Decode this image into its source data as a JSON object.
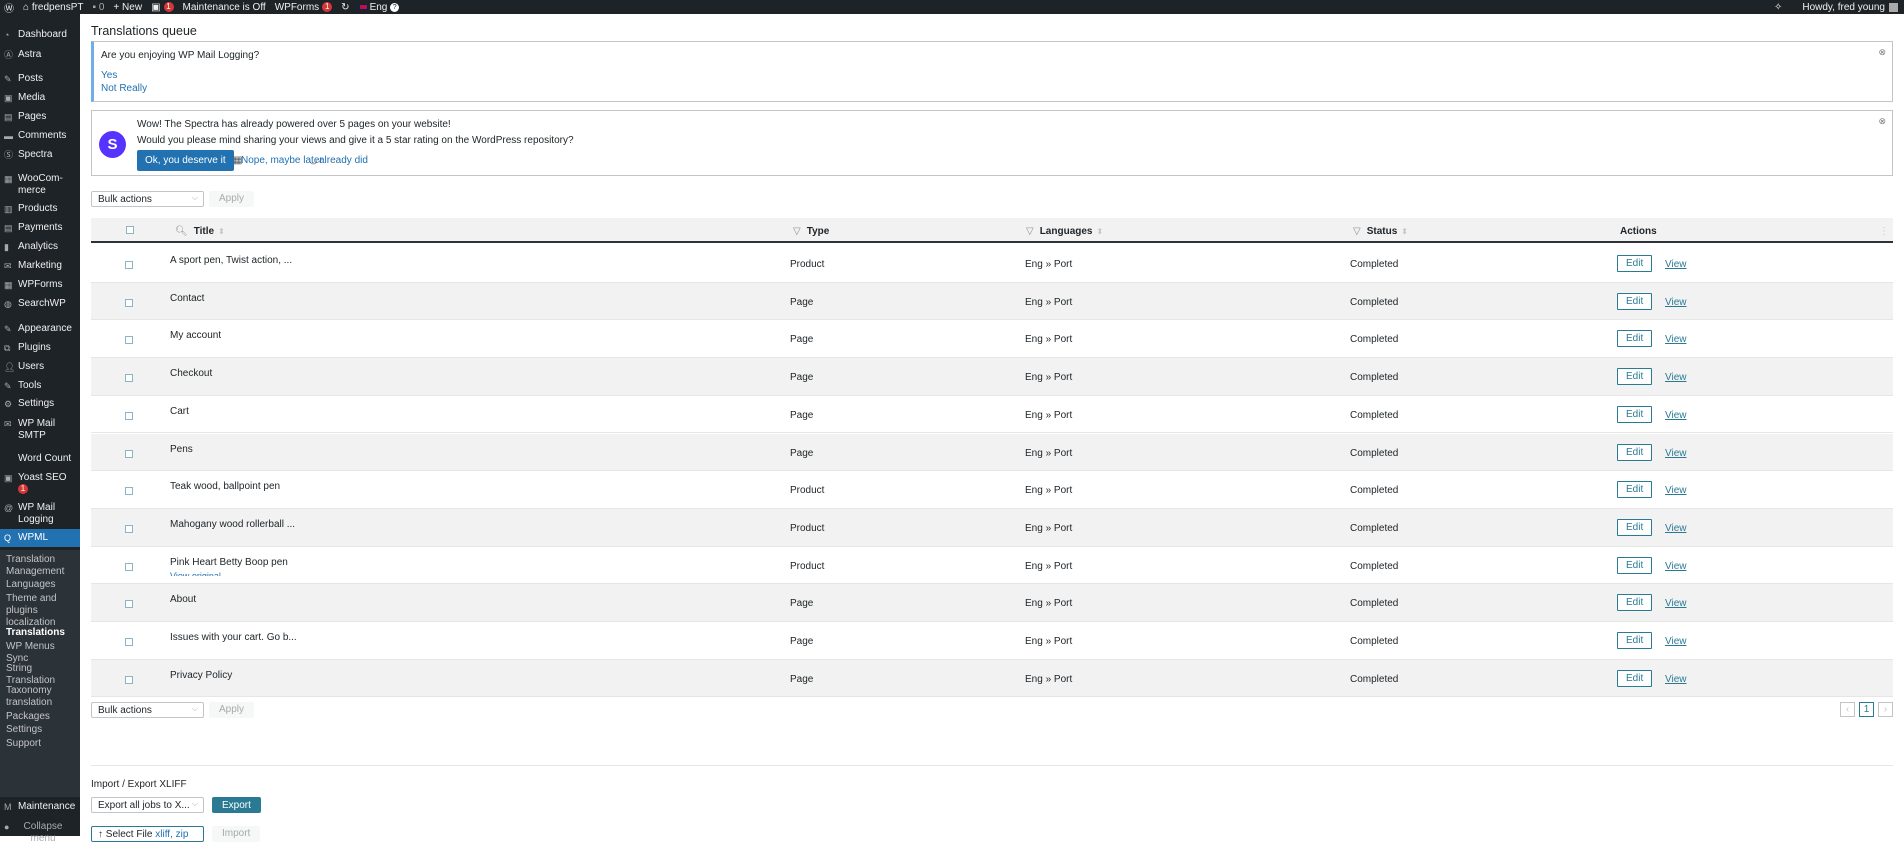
{
  "adminbar": {
    "site": "fredpensPT",
    "comments": "0",
    "new": "New",
    "yoast_badge": "1",
    "maintenance": "Maintenance is Off",
    "wpforms": "WPForms",
    "wpforms_badge": "1",
    "lang": "Eng",
    "howdy": "Howdy, fred young"
  },
  "sidebar": {
    "items": [
      "Dashboard",
      "Astra",
      "Posts",
      "Media",
      "Pages",
      "Comments",
      "Spectra",
      "WooCom-\nmerce",
      "Products",
      "Payments",
      "Analytics",
      "Marketing",
      "WPForms",
      "SearchWP",
      "Appearance",
      "Plugins",
      "Users",
      "Tools",
      "Settings",
      "WP Mail SMTP",
      "Word Count",
      "Yoast SEO",
      "WP Mail Logging",
      "WPML",
      "Maintenance",
      "Collapse menu"
    ],
    "yoast_badge": "1",
    "submenu": [
      "Translation Management",
      "Languages",
      "Theme and plugins localization",
      "Translations",
      "WP Menus Sync",
      "String Translation",
      "Taxonomy translation",
      "Packages",
      "Settings",
      "Support"
    ]
  },
  "page": {
    "title": "Translations queue"
  },
  "notice1": {
    "question": "Are you enjoying WP Mail Logging?",
    "yes": "Yes",
    "no": "Not Really"
  },
  "notice2": {
    "line1": "Wow! The Spectra has already powered over 5 pages on your website!",
    "line2": "Would you please mind sharing your views and give it a 5 star rating on the WordPress repository?",
    "ok": "Ok, you deserve it",
    "later": "Nope, maybe later",
    "did": "already did"
  },
  "bulk": {
    "label": "Bulk actions",
    "apply": "Apply"
  },
  "table": {
    "headers": {
      "title": "Title",
      "type": "Type",
      "languages": "Languages",
      "status": "Status",
      "actions": "Actions"
    },
    "edit": "Edit",
    "view": "View",
    "view_original": "View original",
    "rows": [
      {
        "title": "A sport pen, Twist action, ...",
        "type": "Product",
        "languages": "Eng » Port",
        "status": "Completed"
      },
      {
        "title": "Contact",
        "type": "Page",
        "languages": "Eng » Port",
        "status": "Completed"
      },
      {
        "title": "My account",
        "type": "Page",
        "languages": "Eng » Port",
        "status": "Completed"
      },
      {
        "title": "Checkout",
        "type": "Page",
        "languages": "Eng » Port",
        "status": "Completed"
      },
      {
        "title": "Cart",
        "type": "Page",
        "languages": "Eng » Port",
        "status": "Completed"
      },
      {
        "title": "Pens",
        "type": "Page",
        "languages": "Eng » Port",
        "status": "Completed"
      },
      {
        "title": "Teak wood, ballpoint pen",
        "type": "Product",
        "languages": "Eng » Port",
        "status": "Completed"
      },
      {
        "title": "Mahogany wood rollerball ...",
        "type": "Product",
        "languages": "Eng » Port",
        "status": "Completed"
      },
      {
        "title": "Pink Heart Betty Boop pen",
        "type": "Product",
        "languages": "Eng » Port",
        "status": "Completed"
      },
      {
        "title": "About",
        "type": "Page",
        "languages": "Eng » Port",
        "status": "Completed"
      },
      {
        "title": "Issues with your cart. Go b...",
        "type": "Page",
        "languages": "Eng » Port",
        "status": "Completed"
      },
      {
        "title": "Privacy Policy",
        "type": "Page",
        "languages": "Eng » Port",
        "status": "Completed"
      }
    ]
  },
  "pagination": {
    "prev": "‹",
    "current": "1",
    "next": "›"
  },
  "xliff": {
    "title": "Import / Export XLIFF",
    "select": "Export all jobs to X...",
    "export": "Export",
    "select_file": "Select File",
    "file_types": "xliff, zip",
    "import": "Import"
  }
}
